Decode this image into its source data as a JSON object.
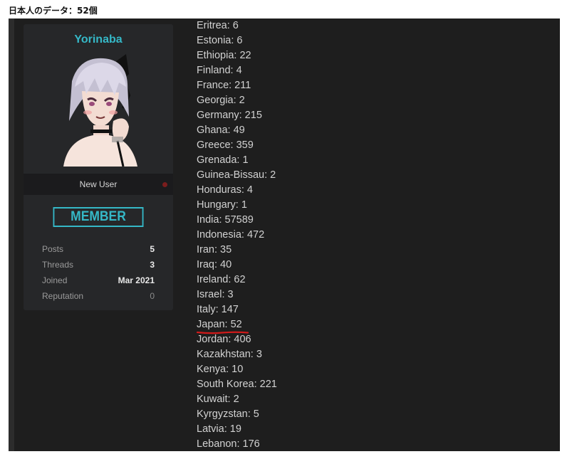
{
  "caption": "日本人のデータ：52個",
  "user": {
    "username": "Yorinaba",
    "rank_title": "New User",
    "badge": "MEMBER",
    "stats": [
      {
        "label": "Posts",
        "value": "5"
      },
      {
        "label": "Threads",
        "value": "3"
      },
      {
        "label": "Joined",
        "value": "Mar 2021"
      },
      {
        "label": "Reputation",
        "value": "0"
      }
    ]
  },
  "countries": [
    "Eritrea: 6",
    "Estonia: 6",
    "Ethiopia: 22",
    "Finland: 4",
    "France: 211",
    "Georgia: 2",
    "Germany: 215",
    "Ghana: 49",
    "Greece: 359",
    "Grenada: 1",
    "Guinea-Bissau: 2",
    "Honduras: 4",
    "Hungary: 1",
    "India: 57589",
    "Indonesia: 472",
    "Iran: 35",
    "Iraq: 40",
    "Ireland: 62",
    "Israel: 3",
    "Italy: 147",
    "Japan: 52",
    "Jordan: 406",
    "Kazakhstan: 3",
    "Kenya: 10",
    "South Korea: 221",
    "Kuwait: 2",
    "Kyrgyzstan: 5",
    "Latvia: 19",
    "Lebanon: 176"
  ],
  "highlighted_country_index": 20,
  "colors": {
    "accent": "#35b8c7",
    "highlight_underline": "#d11a1a"
  }
}
